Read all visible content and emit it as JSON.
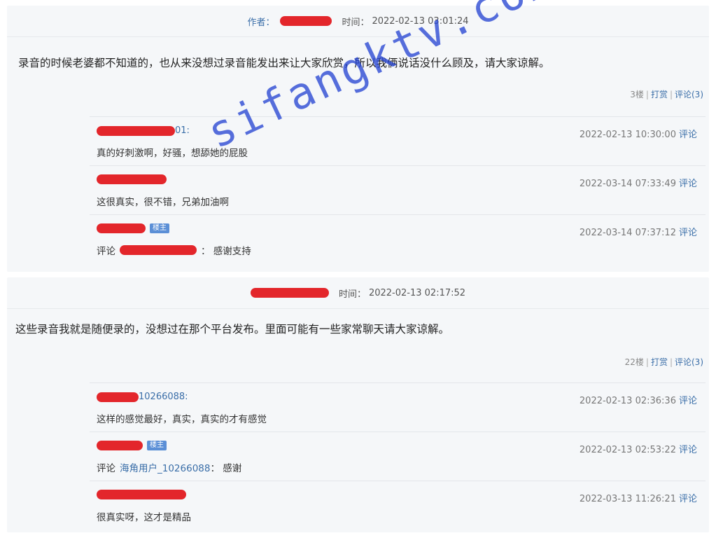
{
  "posts": [
    {
      "author_label": "作者：",
      "time_label": "时间：",
      "time": "2022-02-13 03:01:24",
      "body": "录音的时候老婆都不知道的，也从来没想过录音能发出来让大家欣赏，所以我俩说话没什么顾及，请大家谅解。",
      "floor": "3楼",
      "tip": "打赏",
      "comment_count": "评论(3)",
      "comments": [
        {
          "user_suffix": "01:",
          "badge": "",
          "time": "2022-02-13 10:30:00",
          "reply": "评论",
          "text_prefix": "",
          "text": "真的好刺激啊，好骚，想舔她的屁股"
        },
        {
          "user_suffix": "",
          "badge": "",
          "time": "2022-03-14 07:33:49",
          "reply": "评论",
          "text_prefix": "",
          "text": "这很真实，很不错，兄弟加油啊"
        },
        {
          "user_suffix": "",
          "badge": "楼主",
          "time": "2022-03-14 07:37:12",
          "reply": "评论",
          "text_prefix": "评论",
          "text": "：  感谢支持"
        }
      ]
    },
    {
      "author_label": "",
      "time_label": "时间：",
      "time": "2022-02-13 02:17:52",
      "body": "这些录音我就是随便录的，没想过在那个平台发布。里面可能有一些家常聊天请大家谅解。",
      "floor": "22楼",
      "tip": "打赏",
      "comment_count": "评论(3)",
      "comments": [
        {
          "user_suffix": "10266088:",
          "badge": "",
          "time": "2022-02-13 02:36:36",
          "reply": "评论",
          "text_prefix": "",
          "text": "这样的感觉最好，真实，真实的才有感觉"
        },
        {
          "user_suffix": "",
          "badge": "楼主",
          "time": "2022-02-13 02:53:22",
          "reply": "评论",
          "text_prefix": "评论",
          "text_link": "海角用户_10266088",
          "text": "：  感谢"
        },
        {
          "user_suffix": "",
          "badge": "",
          "time": "2022-03-13 11:26:21",
          "reply": "评论",
          "text_prefix": "",
          "text": "很真实呀，这才是精品"
        }
      ]
    }
  ],
  "watermark": "sifangktv.com",
  "colors": {
    "redaction": "#e3262b",
    "link": "#3a6ea8",
    "watermark": "#2846d2"
  }
}
